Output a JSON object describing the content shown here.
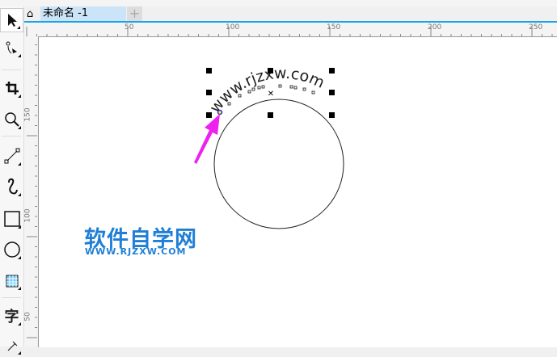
{
  "document_tab": {
    "title": "未命名 -1",
    "add_tab": "+"
  },
  "tools": [
    "pick-tool",
    "shape-tool",
    "crop-tool",
    "zoom-tool",
    "line-tool",
    "artistic-media-tool",
    "rectangle-tool",
    "ellipse-tool",
    "table-tool",
    "text-tool",
    "dimension-tool"
  ],
  "text_tool_glyph": "字",
  "ruler": {
    "h_labels": [
      "50",
      "100",
      "150",
      "200",
      "250"
    ],
    "v_labels": [
      "150",
      "100",
      "50"
    ]
  },
  "canvas": {
    "path_text": "www.rjzxw.com"
  },
  "watermark": {
    "title": "软件自学网",
    "url": "WWW.RJZXW.COM"
  },
  "colors": {
    "accent": "#1aa3e8",
    "arrow": "#ee22ee",
    "watermark": "#1f7fd6"
  }
}
